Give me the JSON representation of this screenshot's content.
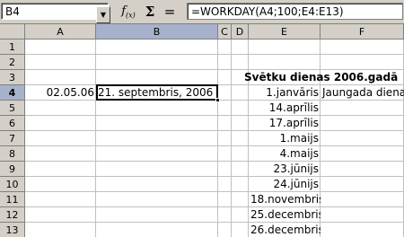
{
  "formula_bar": {
    "cell_ref": "B4",
    "function_icon_label": "f",
    "function_icon_sub": "(x)",
    "sum_label": "Σ",
    "equals_label": "=",
    "formula": "=WORKDAY(A4;100;E4:E13)"
  },
  "columns": [
    "A",
    "B",
    "C",
    "D",
    "E",
    "F"
  ],
  "rows": [
    "1",
    "2",
    "3",
    "4",
    "5",
    "6",
    "7",
    "8",
    "9",
    "10",
    "11",
    "12",
    "13"
  ],
  "selection": {
    "column": "B",
    "row": "4"
  },
  "cells": {
    "A4": "02.05.06",
    "B4": "21. septembris, 2006",
    "E3": "Svētku dienas 2006.gadā",
    "E4": "1.janvāris",
    "F4": "Jaungada diena",
    "E5": "14.aprīlis",
    "E6": "17.aprīlis",
    "E7": "1.maijs",
    "E8": "4.maijs",
    "E9": "23.jūnijs",
    "E10": "24.jūnijs",
    "E11": "18.novembris",
    "E12": "25.decembris",
    "E13": "26.decembris"
  }
}
